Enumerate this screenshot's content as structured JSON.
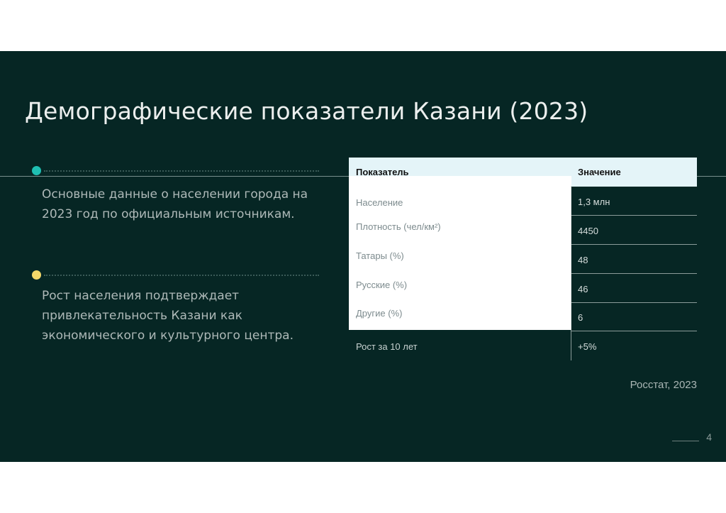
{
  "slide": {
    "title": "Демографические показатели Казани (2023)",
    "bullets": [
      {
        "text": "Основные данные о населении города на 2023 год по официальным источникам.",
        "color": "#1fbfb2"
      },
      {
        "text": "Рост населения подтверждает привлекательность Казани как экономического и культурного центра.",
        "color": "#f5d86a"
      }
    ],
    "table": {
      "headers": {
        "indicator": "Показатель",
        "value": "Значение"
      },
      "rows": [
        {
          "label": "Население",
          "value": "1,3 млн"
        },
        {
          "label": "Плотность (чел/км²)",
          "value": "4450"
        },
        {
          "label": "Татары (%)",
          "value": "48"
        },
        {
          "label": "Русские (%)",
          "value": "46"
        },
        {
          "label": "Другие (%)",
          "value": "6"
        },
        {
          "label": "Рост за 10 лет",
          "value": "+5%"
        }
      ]
    },
    "source": "Росстат, 2023",
    "page_number": "4"
  }
}
